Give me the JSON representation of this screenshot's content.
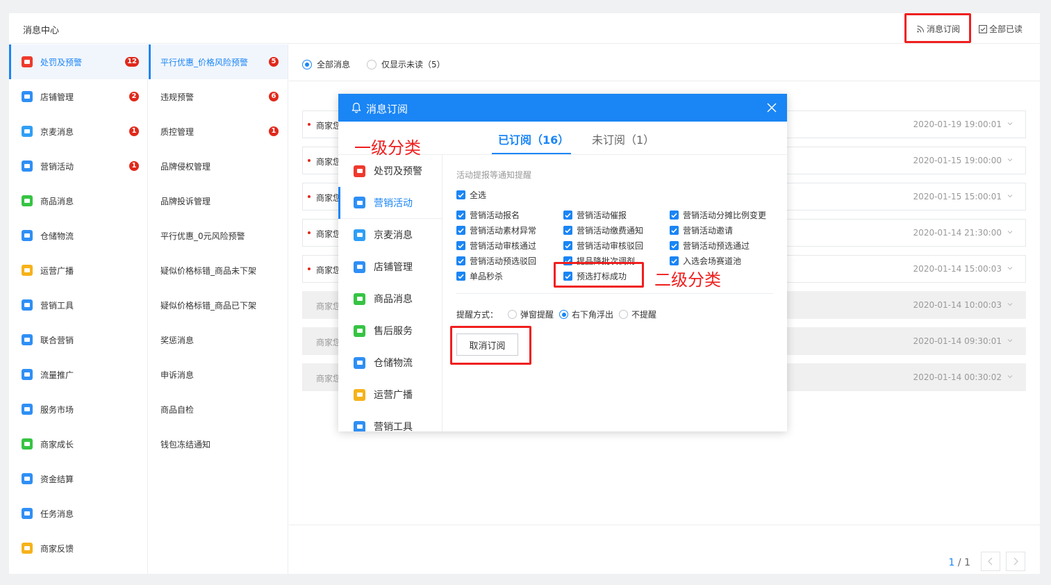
{
  "header": {
    "title": "消息中心",
    "subscribe_label": "消息订阅",
    "read_all_label": "全部已读"
  },
  "categories": [
    {
      "label": "处罚及预警",
      "badge": "12",
      "color": "#ee3a2d",
      "icon": "warning-icon"
    },
    {
      "label": "店铺管理",
      "badge": "2",
      "color": "#2f8ff5",
      "icon": "store-icon"
    },
    {
      "label": "京麦消息",
      "badge": "1",
      "color": "#2f9ff5",
      "icon": "chat-icon"
    },
    {
      "label": "营销活动",
      "badge": "1",
      "color": "#2f8ff5",
      "icon": "megaphone-icon"
    },
    {
      "label": "商品消息",
      "badge": "",
      "color": "#36c443",
      "icon": "product-icon"
    },
    {
      "label": "仓储物流",
      "badge": "",
      "color": "#2f8ff5",
      "icon": "truck-icon"
    },
    {
      "label": "运营广播",
      "badge": "",
      "color": "#f6b21a",
      "icon": "broadcast-icon"
    },
    {
      "label": "营销工具",
      "badge": "",
      "color": "#2f8ff5",
      "icon": "tag-icon"
    },
    {
      "label": "联合营销",
      "badge": "",
      "color": "#2f8ff5",
      "icon": "layers-icon"
    },
    {
      "label": "流量推广",
      "badge": "",
      "color": "#2f8ff5",
      "icon": "traffic-icon"
    },
    {
      "label": "服务市场",
      "badge": "",
      "color": "#2f8ff5",
      "icon": "market-icon"
    },
    {
      "label": "商家成长",
      "badge": "",
      "color": "#36c443",
      "icon": "chart-icon"
    },
    {
      "label": "资金结算",
      "badge": "",
      "color": "#2f8ff5",
      "icon": "wallet-icon"
    },
    {
      "label": "任务消息",
      "badge": "",
      "color": "#2f8ff5",
      "icon": "bell-icon"
    },
    {
      "label": "商家反馈",
      "badge": "",
      "color": "#f6b21a",
      "icon": "feedback-icon"
    }
  ],
  "subcategories": [
    {
      "label": "平行优惠_价格风险预警",
      "badge": "5"
    },
    {
      "label": "违规预警",
      "badge": "6"
    },
    {
      "label": "质控管理",
      "badge": "1"
    },
    {
      "label": "品牌侵权管理",
      "badge": ""
    },
    {
      "label": "品牌投诉管理",
      "badge": ""
    },
    {
      "label": "平行优惠_0元风险预警",
      "badge": ""
    },
    {
      "label": "疑似价格标错_商品未下架",
      "badge": ""
    },
    {
      "label": "疑似价格标错_商品已下架",
      "badge": ""
    },
    {
      "label": "奖惩消息",
      "badge": ""
    },
    {
      "label": "申诉消息",
      "badge": ""
    },
    {
      "label": "商品自检",
      "badge": ""
    },
    {
      "label": "钱包冻结通知",
      "badge": ""
    }
  ],
  "filter": {
    "all_label": "全部消息",
    "unread_label": "仅显示未读（5）",
    "selected": "all"
  },
  "messages": [
    {
      "title": "商家您",
      "time": "2020-01-19 19:00:01",
      "unread": true
    },
    {
      "title": "商家您",
      "time": "2020-01-15 19:00:00",
      "unread": true
    },
    {
      "title": "商家您",
      "time": "2020-01-15 15:00:01",
      "unread": true
    },
    {
      "title": "商家您",
      "time": "2020-01-14 21:30:00",
      "unread": true
    },
    {
      "title": "商家您",
      "time": "2020-01-14 15:00:03",
      "unread": true
    },
    {
      "title": "商家您",
      "time": "2020-01-14 10:00:03",
      "unread": false
    },
    {
      "title": "商家您",
      "time": "2020-01-14 09:30:01",
      "unread": false
    },
    {
      "title": "商家您",
      "time": "2020-01-14 00:30:02",
      "unread": false
    }
  ],
  "pager": {
    "current": "1",
    "total": "/ 1"
  },
  "modal": {
    "title": "消息订阅",
    "tab_subscribed": "已订阅（16）",
    "tab_unsubscribed": "未订阅（1）",
    "side": [
      {
        "label": "处罚及预警",
        "color": "#ee3a2d",
        "icon": "warning-icon"
      },
      {
        "label": "营销活动",
        "color": "#2f8ff5",
        "icon": "megaphone-icon"
      },
      {
        "label": "京麦消息",
        "color": "#2f9ff5",
        "icon": "chat-icon"
      },
      {
        "label": "店铺管理",
        "color": "#2f8ff5",
        "icon": "store-icon"
      },
      {
        "label": "商品消息",
        "color": "#36c443",
        "icon": "product-icon"
      },
      {
        "label": "售后服务",
        "color": "#36c443",
        "icon": "service-icon"
      },
      {
        "label": "仓储物流",
        "color": "#2f8ff5",
        "icon": "truck-icon"
      },
      {
        "label": "运营广播",
        "color": "#f6b21a",
        "icon": "broadcast-icon"
      },
      {
        "label": "营销工具",
        "color": "#2f8ff5",
        "icon": "tag-icon"
      }
    ],
    "section_title": "活动提报等通知提醒",
    "select_all": "全选",
    "options": [
      [
        "营销活动报名",
        "营销活动催报",
        "营销活动分摊比例变更"
      ],
      [
        "营销活动素材异常",
        "营销活动缴费通知",
        "营销活动邀请"
      ],
      [
        "营销活动审核通过",
        "营销活动审核驳回",
        "营销活动预选通过"
      ],
      [
        "营销活动预选驳回",
        "提品降批次调剂",
        "入选会场赛道池"
      ],
      [
        "单品秒杀",
        "预选打标成功"
      ]
    ],
    "remind_label": "提醒方式：",
    "remind_options": [
      "弹窗提醒",
      "右下角浮出",
      "不提醒"
    ],
    "remind_selected": 1,
    "cancel_label": "取消订阅"
  },
  "annotations": {
    "level1": "一级分类",
    "level2": "二级分类"
  }
}
